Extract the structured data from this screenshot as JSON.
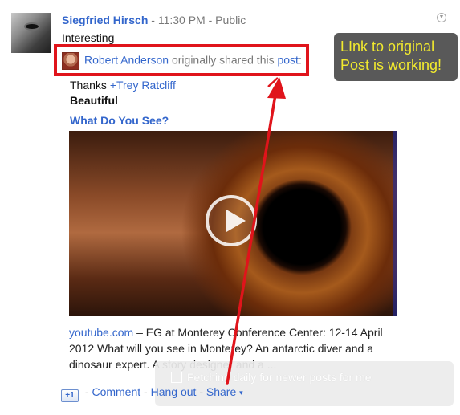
{
  "post": {
    "author": "Siegfried Hirsch",
    "sep1": "-",
    "time": "11:30 PM",
    "sep2": "-",
    "visibility": "Public",
    "text": "Interesting"
  },
  "shared": {
    "original_author": "Robert Anderson",
    "phrase": "originally shared this",
    "post_link": "post",
    "colon": ":"
  },
  "callout": {
    "line1": "LInk to original",
    "line2": "Post is working!",
    "text_color": "#f2ea2e",
    "bg_color": "#595959"
  },
  "content": {
    "thanks_prefix": "Thanks",
    "mention": "+Trey Ratcliff",
    "heading": "Beautiful",
    "video_title": "What Do You See?",
    "source_link": "youtube.com",
    "description": "– EG at Monterey Conference Center: 12-14 April 2012 What will you see in Monterey? An antarctic diver and a dinosaur expert. A story designer and a ..."
  },
  "notification": {
    "text": "Fetching daily for newer posts for me"
  },
  "actions": {
    "plusone": "+1",
    "sep": "-",
    "comment": "Comment",
    "hangout": "Hang out",
    "share": "Share",
    "share_caret": "▾"
  },
  "icons": {
    "menu": "dropdown-icon",
    "play": "play-icon"
  },
  "colors": {
    "link": "#3366cc",
    "highlight": "#e0141b",
    "arrow": "#e0141b"
  }
}
